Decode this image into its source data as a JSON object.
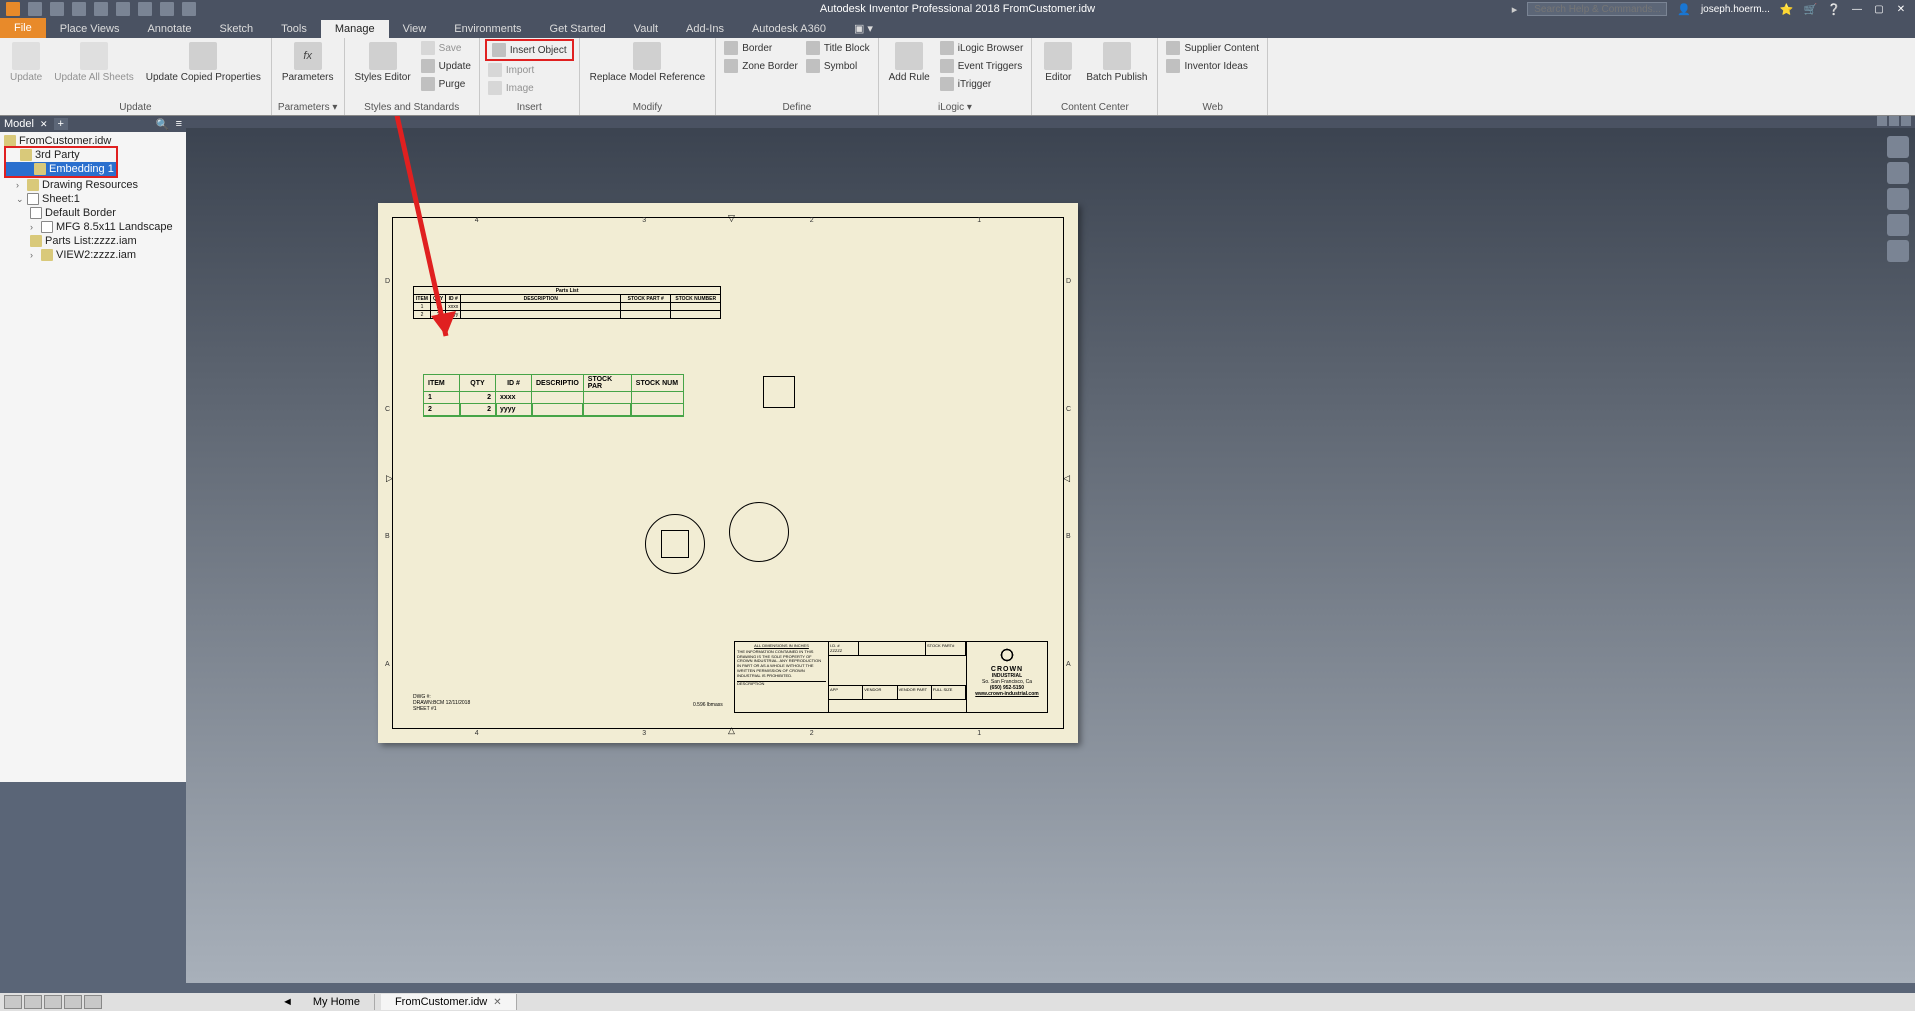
{
  "app": {
    "title": "Autodesk Inventor Professional 2018   FromCustomer.idw",
    "search_placeholder": "Search Help & Commands...",
    "user": "joseph.hoerm..."
  },
  "tabs": {
    "file": "File",
    "items": [
      "Place Views",
      "Annotate",
      "Sketch",
      "Tools",
      "Manage",
      "View",
      "Environments",
      "Get Started",
      "Vault",
      "Add-Ins",
      "Autodesk A360"
    ],
    "active": "Manage"
  },
  "ribbon": {
    "update": {
      "title": "Update",
      "update": "Update",
      "update_all": "Update All Sheets",
      "copied": "Update Copied Properties"
    },
    "parameters": {
      "title": "Parameters ▾",
      "btn": "Parameters"
    },
    "styles": {
      "title": "Styles and Standards",
      "editor": "Styles Editor",
      "save": "Save",
      "update": "Update",
      "purge": "Purge"
    },
    "insert": {
      "title": "Insert",
      "object": "Insert Object",
      "import": "Import",
      "image": "Image"
    },
    "modify": {
      "title": "Modify",
      "replace": "Replace Model Reference"
    },
    "define": {
      "title": "Define",
      "border": "Border",
      "zone": "Zone Border",
      "titleblock": "Title Block",
      "symbol": "Symbol"
    },
    "ilogic": {
      "title": "iLogic ▾",
      "addrule": "Add Rule",
      "browser": "iLogic Browser",
      "triggers": "Event Triggers",
      "itrigger": "iTrigger"
    },
    "content": {
      "title": "Content Center",
      "editor": "Editor",
      "batch": "Batch Publish"
    },
    "web": {
      "title": "Web",
      "supplier": "Supplier Content",
      "ideas": "Inventor Ideas"
    }
  },
  "browser": {
    "header": "Model",
    "root": "FromCustomer.idw",
    "third_party": "3rd Party",
    "embedding": "Embedding 1",
    "resources": "Drawing Resources",
    "sheet": "Sheet:1",
    "border": "Default Border",
    "mfg": "MFG 8.5x11 Landscape",
    "parts": "Parts List:zzzz.iam",
    "view2": "VIEW2:zzzz.iam"
  },
  "partslist": {
    "title": "Parts List",
    "headers": [
      "ITEM",
      "QTY",
      "ID #",
      "DESCRIPTION",
      "STOCK PART #",
      "STOCK NUMBER"
    ],
    "rows": [
      [
        "1",
        "2",
        "xxxx",
        "",
        "",
        ""
      ],
      [
        "2",
        "2",
        "yyyy",
        "",
        "",
        ""
      ]
    ]
  },
  "embedded": {
    "headers": [
      "ITEM",
      "QTY",
      "ID #",
      "DESCRIPTIO",
      "STOCK PAR",
      "STOCK NUM"
    ],
    "rows": [
      [
        "1",
        "2",
        "xxxx",
        "",
        "",
        ""
      ],
      [
        "2",
        "2",
        "yyyy",
        "",
        "",
        ""
      ]
    ]
  },
  "titleblock": {
    "dims": "ALL DIMENSIONS IN INCHES",
    "text": "THE INFORMATION CONTAINED IN THIS DRAWING IS THE SOLE PROPERTY OF CROWN INDUSTRIAL. ANY REPRODUCTION IN PART OR AS A WHOLE WITHOUT THE WRITTEN PERMISSION OF CROWN INDUSTRIAL IS PROHIBITED.",
    "stockpart": "STOCK PART#",
    "id": "I.D. #",
    "zzzz": "ZZZZZ",
    "desc": "DESCRIPTION",
    "app": "APP",
    "vendor": "VENDOR",
    "vendorpart": "VENDOR PART",
    "fullsize": "FULL SIZE",
    "company": "CROWN",
    "company2": "INDUSTRIAL",
    "loc": "So. San Francisco, Ca",
    "phone": "(650) 952-5150",
    "web": "www.crown-industrial.com"
  },
  "dwginfo": {
    "dwg": "DWG #:",
    "drawn": "DRAWN:BCM   12/11/2018",
    "sheet": "SHEET #1",
    "mass": "0.596 lbmass"
  },
  "bottomtabs": {
    "home": "My Home",
    "doc": "FromCustomer.idw"
  }
}
